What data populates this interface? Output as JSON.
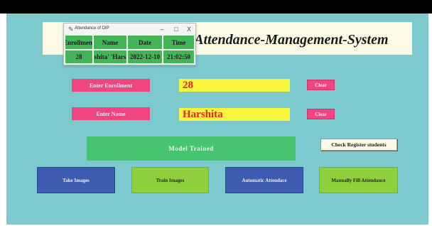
{
  "app": {
    "title": "l-Attendance-Management-System"
  },
  "popup": {
    "title": "Attendance of DIP",
    "minimize": "–",
    "maximize": "□",
    "close": "X",
    "columns": [
      "Enrollment",
      "Name",
      "Date",
      "Time"
    ],
    "row": [
      "28",
      "shita' 'Hars",
      "2022-12-10",
      "21:02:50"
    ]
  },
  "form": {
    "enrollment_label": "Enter Enrollment",
    "enrollment_value": "28",
    "name_label": "Enter Name",
    "name_value": "Harshita",
    "clear_label": "Clear"
  },
  "status": {
    "message": "Model Trained"
  },
  "buttons": {
    "check_register": "Check Register students",
    "take_images": "Take Images",
    "train_images": "Train Images",
    "automatic_attendance": "Automatic Attendace",
    "manual_attendance": "Manually Fill Attendance"
  },
  "colors": {
    "background": "#7cc9ce",
    "accent_pink": "#f0457f",
    "field_yellow": "#f5f53c",
    "value_red": "#e8211e",
    "status_green": "#47c46f",
    "button_blue": "#3d5bb0",
    "button_lime": "#8fce3c"
  }
}
